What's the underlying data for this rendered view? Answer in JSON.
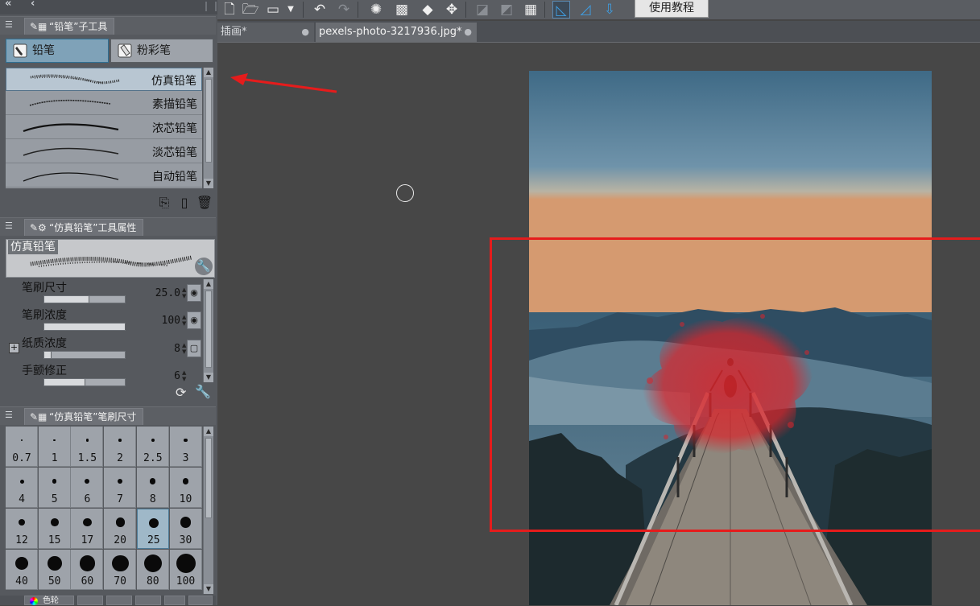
{
  "left_panel": {
    "subtool_panel": {
      "title": "“铅笔”子工具",
      "groups": [
        {
          "label": "铅笔",
          "icon": "pencil-icon",
          "active": true
        },
        {
          "label": "粉彩笔",
          "icon": "pastel-icon",
          "active": false
        }
      ],
      "brushes": [
        {
          "name": "仿真铅笔",
          "selected": true
        },
        {
          "name": "素描铅笔",
          "selected": false
        },
        {
          "name": "浓芯铅笔",
          "selected": false
        },
        {
          "name": "淡芯铅笔",
          "selected": false
        },
        {
          "name": "自动铅笔",
          "selected": false
        }
      ]
    },
    "property_panel": {
      "title": "“仿真铅笔”工具属性",
      "preview_name": "仿真铅笔",
      "properties": [
        {
          "label": "笔刷尺寸",
          "value": "25.0",
          "level": 0.55
        },
        {
          "label": "笔刷浓度",
          "value": "100",
          "level": 1.0
        },
        {
          "label": "纸质浓度",
          "value": "8",
          "level": 0.08
        },
        {
          "label": "手颤修正",
          "value": "6",
          "level": 0.5
        }
      ]
    },
    "size_panel": {
      "title": "“仿真铅笔”笔刷尺寸",
      "sizes": [
        "0.7",
        "1",
        "1.5",
        "2",
        "2.5",
        "3",
        "4",
        "5",
        "6",
        "7",
        "8",
        "10",
        "12",
        "15",
        "17",
        "20",
        "25",
        "30",
        "40",
        "50",
        "60",
        "70",
        "80",
        "100"
      ],
      "selected": "25"
    },
    "bottom_tab_label": "色轮"
  },
  "toolbar": {
    "tutorial_label": "使用教程"
  },
  "doc_tabs": [
    {
      "label": "插画*",
      "active": false
    },
    {
      "label": "pexels-photo-3217936.jpg*",
      "active": true
    }
  ],
  "colors": {
    "annotation_red": "#e51c1c",
    "selection_blue": "#7fa2b8",
    "paint_red": "#d9252b"
  }
}
